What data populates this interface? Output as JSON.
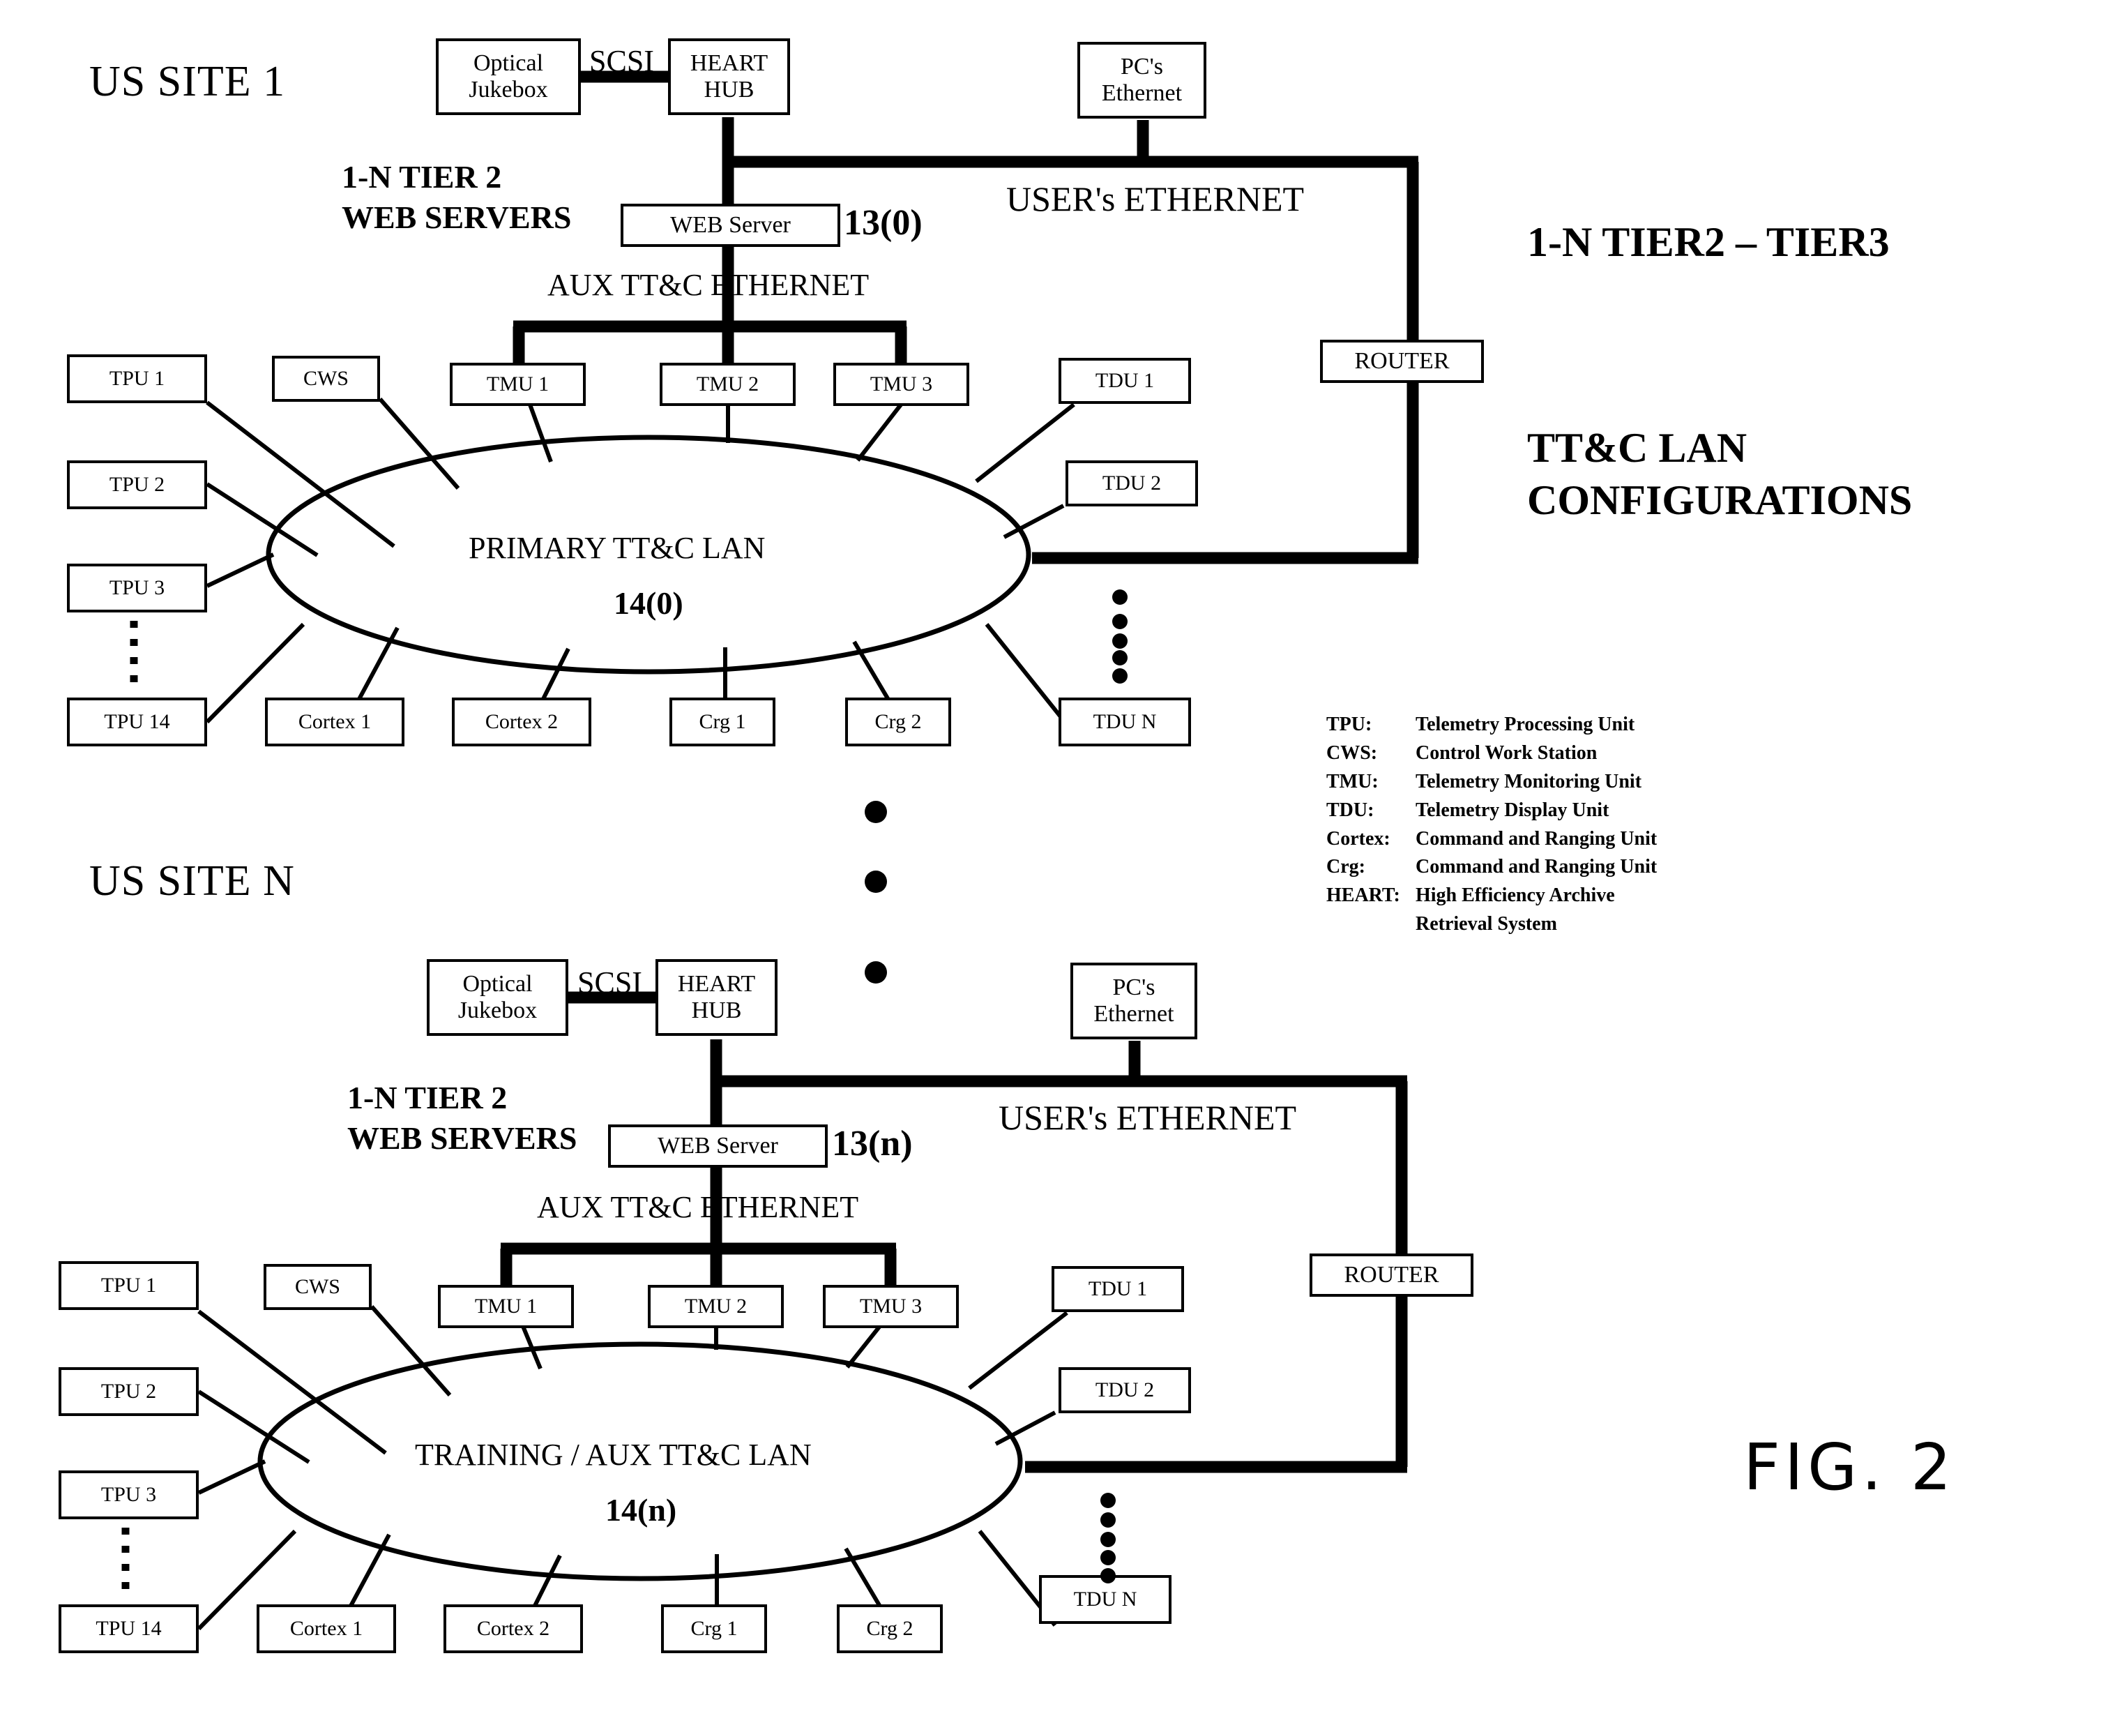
{
  "figure": {
    "label": "FIG. 2"
  },
  "sites": [
    {
      "id": "site1",
      "title": "US SITE 1",
      "tier_label_line1": "1-N TIER 2",
      "tier_label_line2": "WEB SERVERS",
      "jukebox": "Optical\nJukebox",
      "scsi": "SCSI",
      "hub": "HEART\nHUB",
      "pcs": "PC's\nEthernet",
      "web_server": "WEB Server",
      "web_server_ref": "13(0)",
      "users_ethernet": "USER's ETHERNET",
      "aux_ethernet": "AUX TT&C ETHERNET",
      "router": "ROUTER",
      "lan_name": "PRIMARY TT&C LAN",
      "lan_ref": "14(0)",
      "tmus": [
        "TMU 1",
        "TMU 2",
        "TMU 3"
      ],
      "tpus": [
        "TPU 1",
        "TPU 2",
        "TPU 3",
        "TPU 14"
      ],
      "cws": "CWS",
      "cortex": [
        "Cortex 1",
        "Cortex 2"
      ],
      "crg": [
        "Crg 1",
        "Crg 2"
      ],
      "tdus": [
        "TDU 1",
        "TDU 2",
        "TDU N"
      ]
    },
    {
      "id": "siteN",
      "title": "US SITE N",
      "tier_label_line1": "1-N TIER 2",
      "tier_label_line2": "WEB SERVERS",
      "jukebox": "Optical\nJukebox",
      "scsi": "SCSI",
      "hub": "HEART\nHUB",
      "pcs": "PC's\nEthernet",
      "web_server": "WEB Server",
      "web_server_ref": "13(n)",
      "users_ethernet": "USER's ETHERNET",
      "aux_ethernet": "AUX TT&C ETHERNET",
      "router": "ROUTER",
      "lan_name": "TRAINING / AUX TT&C LAN",
      "lan_ref": "14(n)",
      "tmus": [
        "TMU 1",
        "TMU 2",
        "TMU 3"
      ],
      "tpus": [
        "TPU 1",
        "TPU 2",
        "TPU 3",
        "TPU 14"
      ],
      "cws": "CWS",
      "cortex": [
        "Cortex 1",
        "Cortex 2"
      ],
      "crg": [
        "Crg 1",
        "Crg 2"
      ],
      "tdus": [
        "TDU 1",
        "TDU 2",
        "TDU N"
      ]
    }
  ],
  "annotations": {
    "tier2_tier3": "1-N TIER2 – TIER3",
    "config_line1": "TT&C LAN",
    "config_line2": "CONFIGURATIONS"
  },
  "legend": {
    "rows": [
      {
        "key": "TPU:",
        "value": "Telemetry Processing Unit"
      },
      {
        "key": "CWS:",
        "value": "Control Work Station"
      },
      {
        "key": "TMU:",
        "value": "Telemetry Monitoring Unit"
      },
      {
        "key": "TDU:",
        "value": "Telemetry Display Unit"
      },
      {
        "key": "Cortex:",
        "value": "Command and Ranging Unit"
      },
      {
        "key": "Crg:",
        "value": "Command and Ranging Unit"
      },
      {
        "key": "HEART:",
        "value": "High Efficiency Archive"
      },
      {
        "key": "",
        "value": "Retrieval System"
      }
    ]
  },
  "colors": {
    "ink": "#000000",
    "paper": "#ffffff"
  }
}
